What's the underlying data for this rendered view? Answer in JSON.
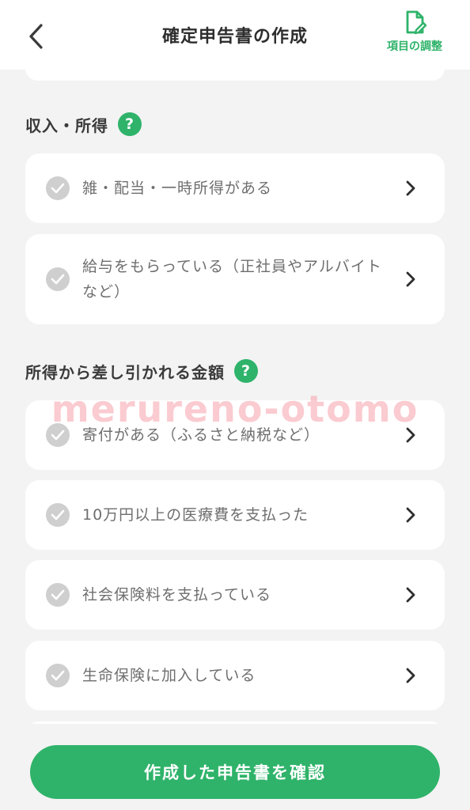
{
  "header": {
    "title": "確定申告書の作成",
    "adjust_label": "項目の調整",
    "back_icon": "chevron-left-icon",
    "adjust_icon": "document-edit-icon"
  },
  "sections": [
    {
      "title": "収入・所得",
      "help_icon": "?",
      "items": [
        {
          "label": "雑・配当・一時所得がある"
        },
        {
          "label": "給与をもらっている（正社員やアルバイトなど）"
        }
      ]
    },
    {
      "title": "所得から差し引かれる金額",
      "help_icon": "?",
      "items": [
        {
          "label": "寄付がある（ふるさと納税など）"
        },
        {
          "label": "10万円以上の医療費を支払った"
        },
        {
          "label": "社会保険料を支払っている"
        },
        {
          "label": "生命保険に加入している"
        }
      ]
    }
  ],
  "watermark": "merureno-otomo",
  "confirm_button": "作成した申告書を確認",
  "colors": {
    "accent": "#2fb36a",
    "background": "#f3f3f3",
    "check_inactive": "#cfcfcf",
    "watermark": "#f6a0aa"
  }
}
